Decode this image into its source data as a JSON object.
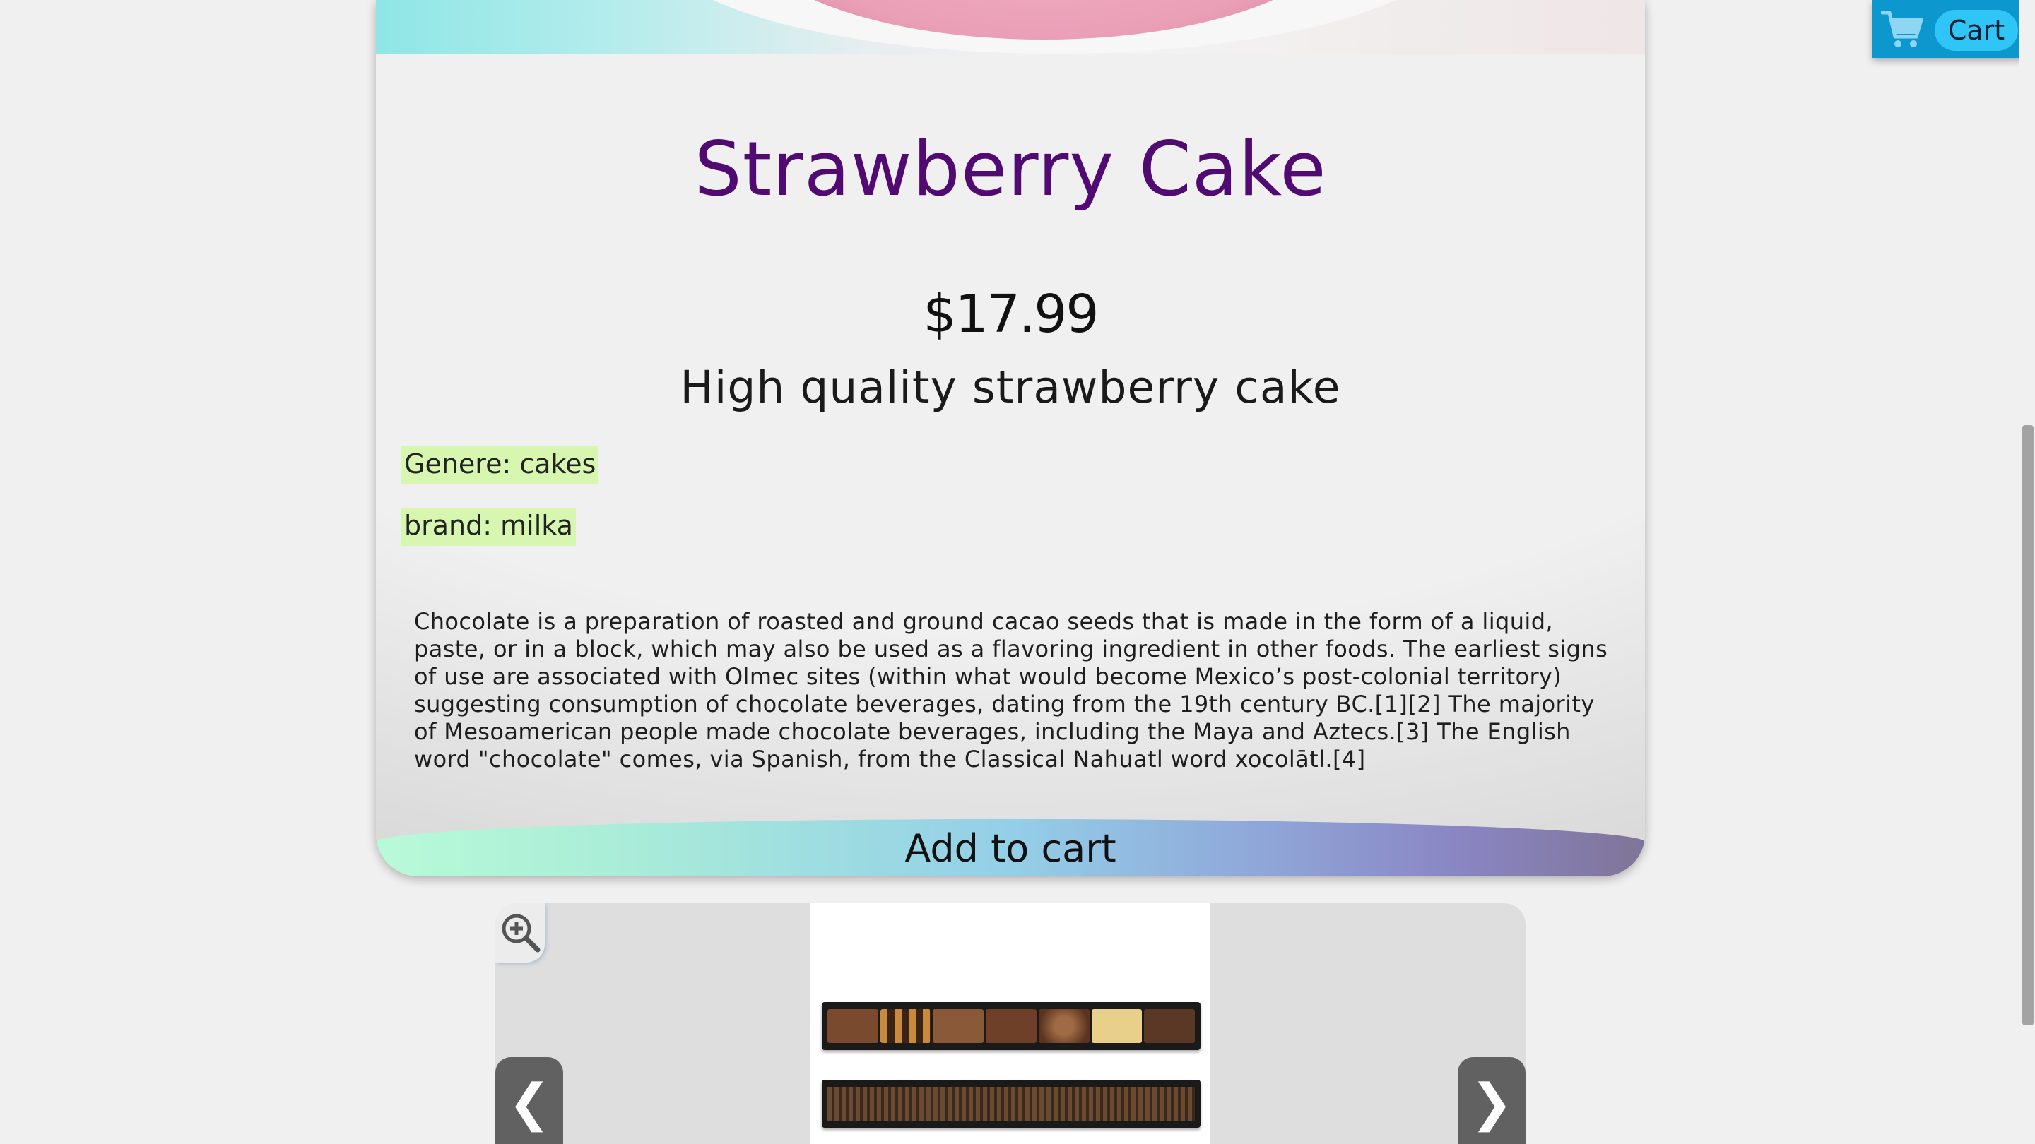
{
  "cart": {
    "label": "Cart",
    "icon": "shopping-cart-icon",
    "background_color": "#0d97cf",
    "label_color": "#2fc5f7"
  },
  "product": {
    "title": "Strawberry Cake",
    "price": "$17.99",
    "subtitle": "High quality strawberry cake",
    "genre_tag": "Genere: cakes",
    "brand_tag": "brand: milka",
    "description": "Chocolate is a preparation of roasted and ground cacao seeds that is made in the form of a liquid, paste, or in a block, which may also be used as a flavoring ingredient in other foods. The earliest signs of use are associated with Olmec sites (within what would become Mexico’s post-colonial territory) suggesting consumption of chocolate beverages, dating from the 19th century BC.[1][2] The majority of Mesoamerican people made chocolate beverages, including the Maya and Aztecs.[3] The English word \"chocolate\" comes, via Spanish, from the Classical Nahuatl word xocolātl.[4]",
    "add_to_cart_label": "Add to cart",
    "title_color": "#520a73",
    "tag_color": "#d7f7b1"
  },
  "gallery": {
    "zoom_icon": "zoom-in-icon",
    "prev_label": "❮",
    "next_label": "❯"
  }
}
